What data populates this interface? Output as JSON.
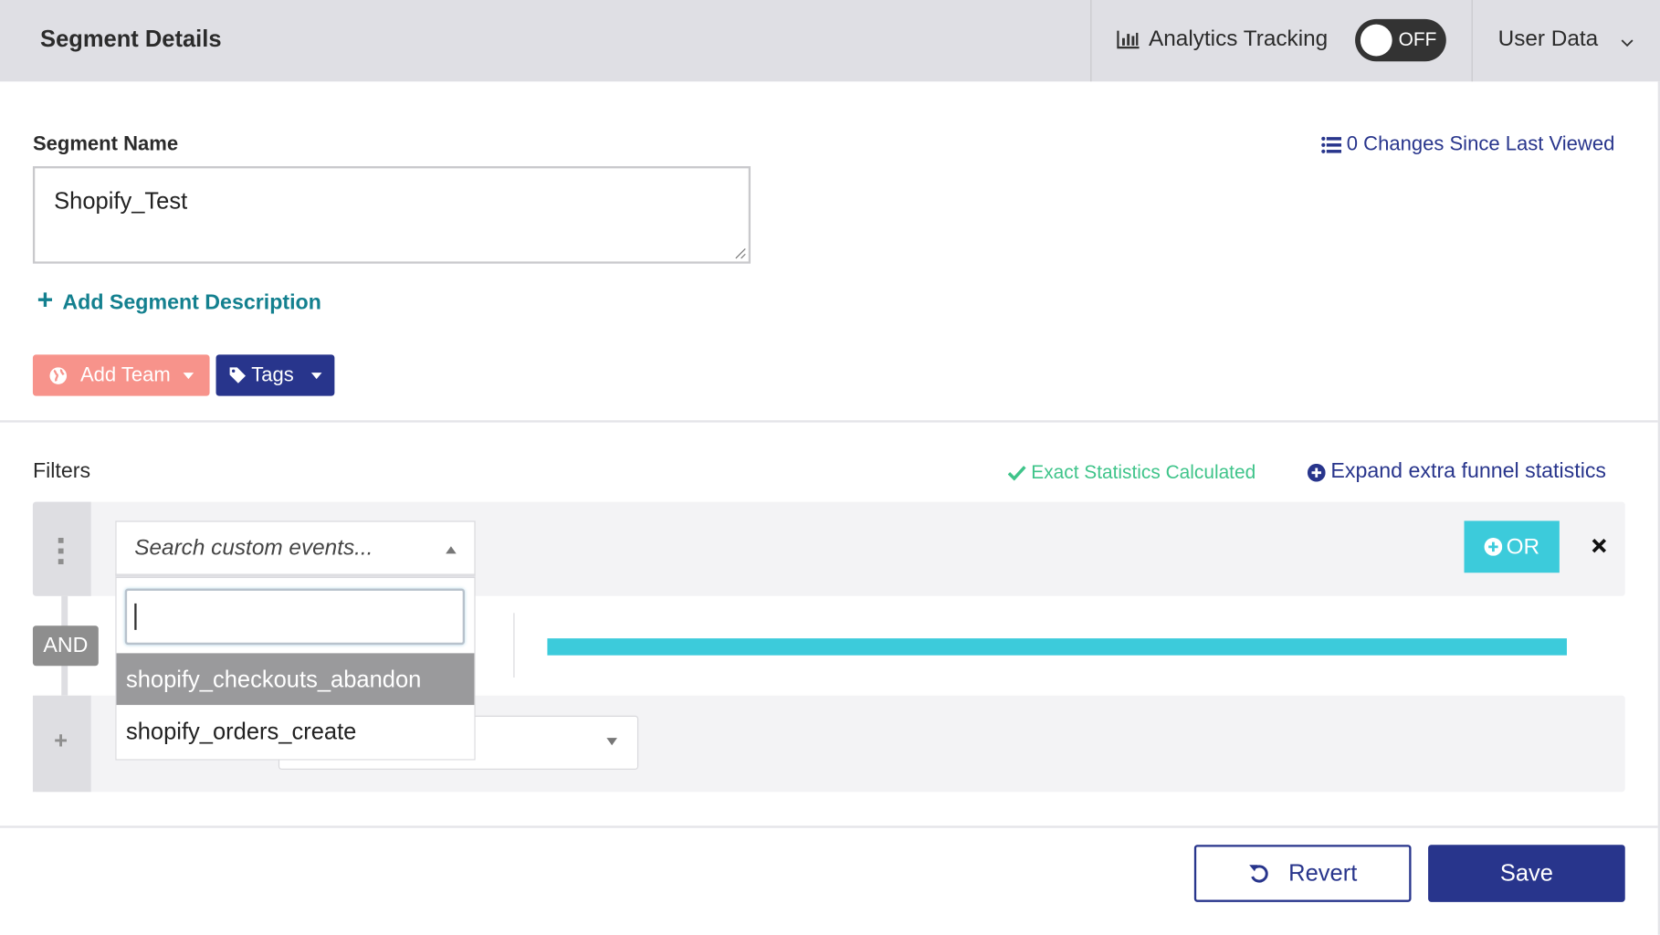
{
  "header": {
    "title": "Segment Details",
    "analytics_label": "Analytics Tracking",
    "analytics_toggle": "OFF",
    "analytics_enabled": false,
    "user_data_label": "User Data"
  },
  "form": {
    "name_label": "Segment Name",
    "name_value": "Shopify_Test",
    "changes_link": "0 Changes Since Last Viewed",
    "add_description": "Add Segment Description",
    "add_team": "Add Team",
    "tags": "Tags"
  },
  "filters": {
    "label": "Filters",
    "exact_stats": "Exact Statistics Calculated",
    "expand_stats": "Expand extra funnel statistics",
    "search_placeholder": "Search custom events...",
    "search_input_value": "",
    "options": [
      "shopify_checkouts_abandon",
      "shopify_orders_create"
    ],
    "highlighted_option": "shopify_checkouts_abandon",
    "or_button": "OR",
    "and_badge": "AND"
  },
  "footer": {
    "revert": "Revert",
    "save": "Save"
  },
  "colors": {
    "navy": "#28358c",
    "teal": "#13808f",
    "cyan": "#3ccbdb",
    "salmon": "#f7938b",
    "green": "#3fc48a"
  }
}
